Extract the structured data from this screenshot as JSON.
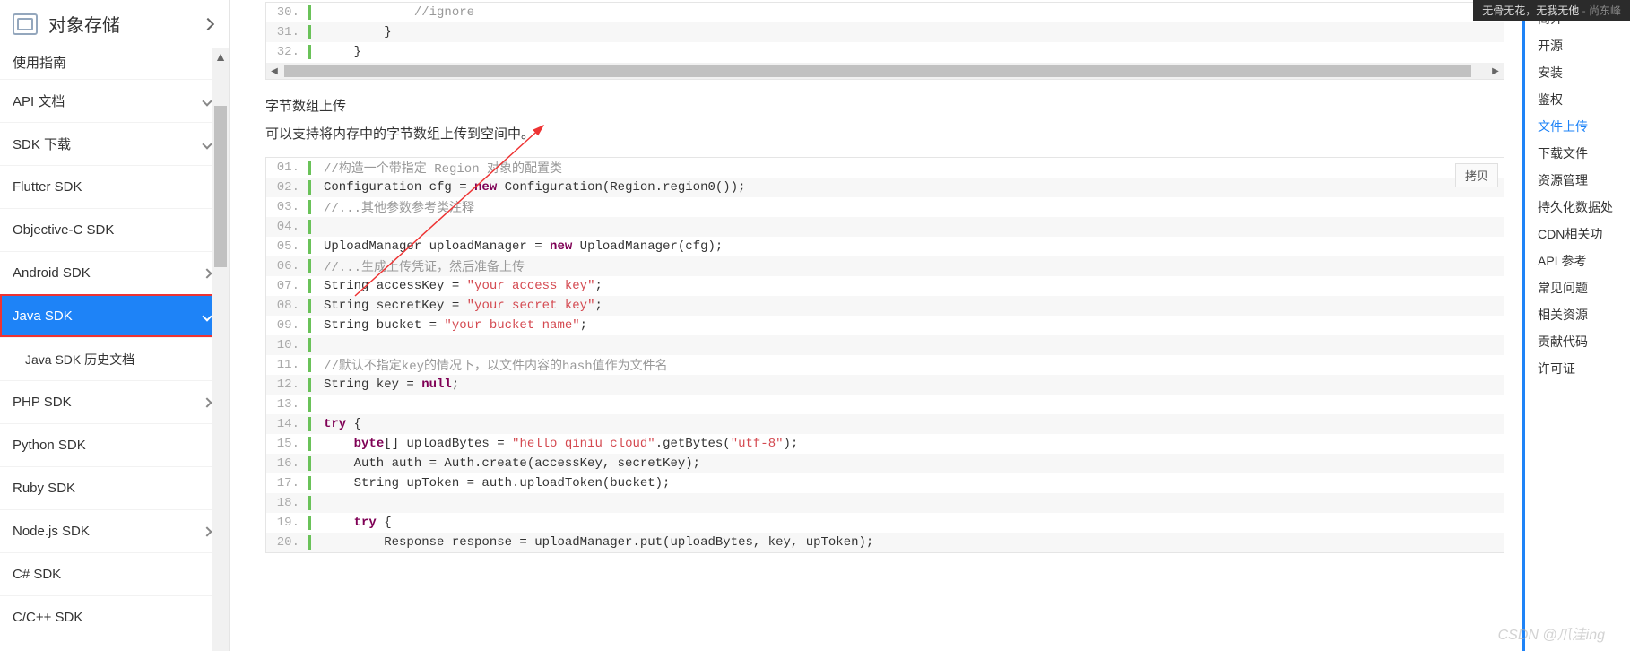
{
  "header": {
    "title": "对象存储"
  },
  "sidebar": {
    "items": [
      {
        "label": "使用指南",
        "kind": "cut"
      },
      {
        "label": "API 文档",
        "expand": "down"
      },
      {
        "label": "SDK 下载",
        "expand": "down"
      },
      {
        "label": "Flutter SDK"
      },
      {
        "label": "Objective-C SDK"
      },
      {
        "label": "Android SDK",
        "expand": "right"
      },
      {
        "label": "Java SDK",
        "expand": "down",
        "active": true,
        "boxed": true
      },
      {
        "label": "Java SDK 历史文档",
        "sub": true
      },
      {
        "label": "PHP SDK",
        "expand": "right"
      },
      {
        "label": "Python SDK"
      },
      {
        "label": "Ruby SDK"
      },
      {
        "label": "Node.js SDK",
        "expand": "right"
      },
      {
        "label": "C# SDK"
      },
      {
        "label": "C/C++ SDK"
      }
    ]
  },
  "code_top": {
    "start": 30,
    "lines": [
      {
        "n": "30.",
        "t": "            //ignore",
        "cls": "cmt"
      },
      {
        "n": "31.",
        "t": "        }"
      },
      {
        "n": "32.",
        "t": "    }"
      }
    ]
  },
  "section": {
    "title": "字节数组上传",
    "desc": "可以支持将内存中的字节数组上传到空间中。"
  },
  "copy_label": "拷贝",
  "code_main": {
    "lines": [
      {
        "n": "01.",
        "seg": [
          {
            "t": "//构造一个带指定 Region 对象的配置类",
            "c": "cmt"
          }
        ]
      },
      {
        "n": "02.",
        "seg": [
          {
            "t": "Configuration cfg = "
          },
          {
            "t": "new",
            "c": "k-new"
          },
          {
            "t": " Configuration(Region.region0());"
          }
        ]
      },
      {
        "n": "03.",
        "seg": [
          {
            "t": "//...其他参数参考类注释",
            "c": "cmt"
          }
        ]
      },
      {
        "n": "04.",
        "seg": []
      },
      {
        "n": "05.",
        "seg": [
          {
            "t": "UploadManager uploadManager = "
          },
          {
            "t": "new",
            "c": "k-new"
          },
          {
            "t": " UploadManager(cfg);"
          }
        ]
      },
      {
        "n": "06.",
        "seg": [
          {
            "t": "//...生成上传凭证，然后准备上传",
            "c": "cmt"
          }
        ]
      },
      {
        "n": "07.",
        "seg": [
          {
            "t": "String accessKey = "
          },
          {
            "t": "\"your access key\"",
            "c": "str"
          },
          {
            "t": ";"
          }
        ]
      },
      {
        "n": "08.",
        "seg": [
          {
            "t": "String secretKey = "
          },
          {
            "t": "\"your secret key\"",
            "c": "str"
          },
          {
            "t": ";"
          }
        ]
      },
      {
        "n": "09.",
        "seg": [
          {
            "t": "String bucket = "
          },
          {
            "t": "\"your bucket name\"",
            "c": "str"
          },
          {
            "t": ";"
          }
        ]
      },
      {
        "n": "10.",
        "seg": []
      },
      {
        "n": "11.",
        "seg": [
          {
            "t": "//默认不指定key的情况下，以文件内容的hash值作为文件名",
            "c": "cmt"
          }
        ]
      },
      {
        "n": "12.",
        "seg": [
          {
            "t": "String key = "
          },
          {
            "t": "null",
            "c": "k-key"
          },
          {
            "t": ";"
          }
        ]
      },
      {
        "n": "13.",
        "seg": []
      },
      {
        "n": "14.",
        "seg": [
          {
            "t": "try",
            "c": "k-key"
          },
          {
            "t": " {"
          }
        ]
      },
      {
        "n": "15.",
        "seg": [
          {
            "t": "    "
          },
          {
            "t": "byte",
            "c": "k-key"
          },
          {
            "t": "[] uploadBytes = "
          },
          {
            "t": "\"hello qiniu cloud\"",
            "c": "str"
          },
          {
            "t": ".getBytes("
          },
          {
            "t": "\"utf-8\"",
            "c": "str"
          },
          {
            "t": ");"
          }
        ]
      },
      {
        "n": "16.",
        "seg": [
          {
            "t": "    Auth auth = Auth.create(accessKey, secretKey);"
          }
        ]
      },
      {
        "n": "17.",
        "seg": [
          {
            "t": "    String upToken = auth.uploadToken(bucket);"
          }
        ]
      },
      {
        "n": "18.",
        "seg": []
      },
      {
        "n": "19.",
        "seg": [
          {
            "t": "    "
          },
          {
            "t": "try",
            "c": "k-key"
          },
          {
            "t": " {"
          }
        ]
      },
      {
        "n": "20.",
        "seg": [
          {
            "t": "        Response response = uploadManager.put(uploadBytes, key, upToken);"
          }
        ]
      }
    ]
  },
  "toc": {
    "items": [
      {
        "label": "简介"
      },
      {
        "label": "开源"
      },
      {
        "label": "安装"
      },
      {
        "label": "鉴权"
      },
      {
        "label": "文件上传",
        "active": true
      },
      {
        "label": "下载文件"
      },
      {
        "label": "资源管理"
      },
      {
        "label": "持久化数据处"
      },
      {
        "label": "CDN相关功"
      },
      {
        "label": "API 参考"
      },
      {
        "label": "常见问题"
      },
      {
        "label": "相关资源"
      },
      {
        "label": "贡献代码"
      },
      {
        "label": "许可证"
      }
    ]
  },
  "ribbon": {
    "text": "无骨无花，无我无他",
    "author": "- 尚东峰"
  },
  "watermark": "CSDN @爪洼ing"
}
